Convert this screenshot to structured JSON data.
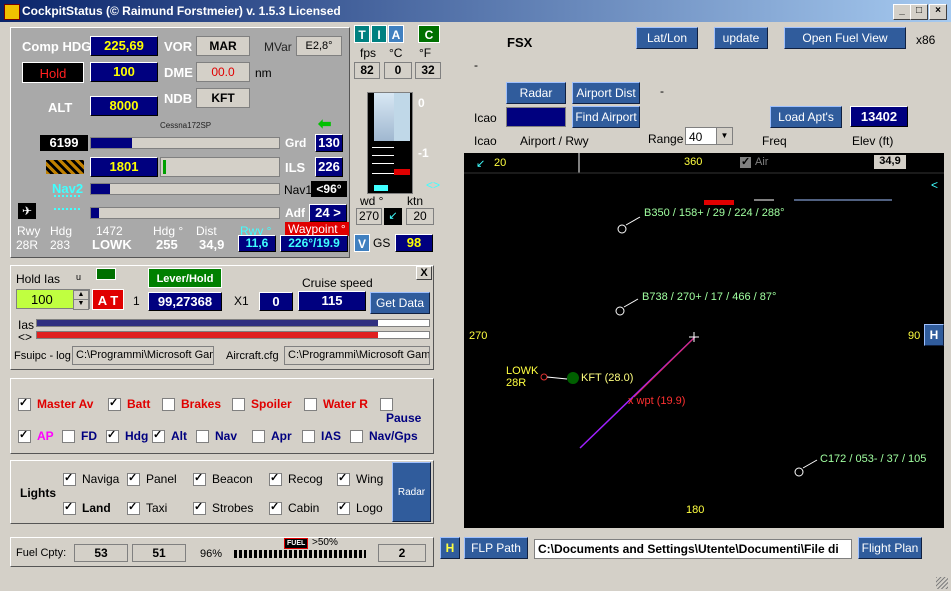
{
  "window": {
    "title": "CockpitStatus (© Raimund Forstmeier) v. 1.5.3 Licensed"
  },
  "instruments": {
    "comp_hdg_label": "Comp HDG",
    "comp_hdg": "225,69",
    "vor_label": "VOR",
    "vor": "MAR",
    "mvar_label": "MVar",
    "mvar": "E2,8°",
    "hold_label": "Hold",
    "hold_val": "100",
    "dme_label": "DME",
    "dme": "00.0",
    "dme_unit": "nm",
    "alt_label": "ALT",
    "alt": "8000",
    "ndb_label": "NDB",
    "ndb": "KFT",
    "aircraft": "Cessna172SP",
    "bar1_val": "6199",
    "grd_label": "Grd",
    "grd": "130",
    "bar2_val": "1801",
    "ils_label": "ILS",
    "ils": "226",
    "nav2_label": "Nav2",
    "nav1_label": "Nav1",
    "nav1": "<96°",
    "adf_label": "Adf",
    "adf": "24 >",
    "rwy_h": "Rwy",
    "hdg_h": "Hdg",
    "num_h": "1472",
    "hdgdeg_h": "Hdg °",
    "dist_h": "Dist",
    "rwy_deg_h": "Rwy °",
    "waypoint_h": "Waypoint °",
    "rwy": "28R",
    "hdg": "283",
    "apt": "LOWK",
    "hdg2": "255",
    "dist": "34,9",
    "rwy_deg": "11,6",
    "waypoint": "226°/19.9"
  },
  "env": {
    "t_btn": "T",
    "i_btn": "I",
    "a_btn": "A",
    "c_btn": "C",
    "fps_h": "fps",
    "c_h": "°C",
    "f_h": "°F",
    "fps": "82",
    "c": "0",
    "f": "32",
    "scale_0": "0",
    "scale_m1": "-1",
    "wd_label": "wd °",
    "ktn_label": "ktn",
    "wd": "270",
    "ktn": "20",
    "v_btn": "V",
    "gs_label": "GS",
    "gs": "98",
    "arrows": "<>"
  },
  "autothrottle": {
    "hold_ias_label": "Hold Ias",
    "u_label": "u",
    "ias_value": "100",
    "at_btn": "A T",
    "one": "1",
    "lever_btn": "Lever/Hold",
    "lever_val": "99,27368",
    "x1_label": "X1",
    "x1_val": "0",
    "cruise_label": "Cruise speed",
    "cruise_val": "115",
    "get_data_btn": "Get Data",
    "ias_label": "Ias",
    "arrows_label": "<>",
    "fsuipc_label": "Fsuipc - log",
    "fsuipc_path": "C:\\Programmi\\Microsoft Gam",
    "aircraft_cfg_label": "Aircraft.cfg",
    "aircraft_path": "C:\\Programmi\\Microsoft Gam",
    "close": "X"
  },
  "switches": {
    "row1": [
      {
        "label": "Master Av",
        "checked": true,
        "color": "red"
      },
      {
        "label": "Batt",
        "checked": true,
        "color": "red"
      },
      {
        "label": "Brakes",
        "checked": false,
        "color": "red"
      },
      {
        "label": "Spoiler",
        "checked": false,
        "color": "red"
      },
      {
        "label": "Water R",
        "checked": false,
        "color": "red"
      },
      {
        "label": "Pause",
        "checked": false,
        "color": "navy"
      }
    ],
    "row2": [
      {
        "label": "AP",
        "checked": true,
        "color": "magenta"
      },
      {
        "label": "FD",
        "checked": false,
        "color": "navy"
      },
      {
        "label": "Hdg",
        "checked": true,
        "color": "navy"
      },
      {
        "label": "Alt",
        "checked": true,
        "color": "navy"
      },
      {
        "label": "Nav",
        "checked": false,
        "color": "navy"
      },
      {
        "label": "Apr",
        "checked": false,
        "color": "navy"
      },
      {
        "label": "IAS",
        "checked": false,
        "color": "navy"
      },
      {
        "label": "Nav/Gps",
        "checked": false,
        "color": "navy"
      }
    ]
  },
  "lights": {
    "label": "Lights",
    "row1": [
      {
        "label": "Naviga",
        "checked": true
      },
      {
        "label": "Panel",
        "checked": true
      },
      {
        "label": "Beacon",
        "checked": true
      },
      {
        "label": "Recog",
        "checked": true
      },
      {
        "label": "Wing",
        "checked": true
      }
    ],
    "row2": [
      {
        "label": "Land",
        "checked": true,
        "bold": true
      },
      {
        "label": "Taxi",
        "checked": true
      },
      {
        "label": "Strobes",
        "checked": true
      },
      {
        "label": "Cabin",
        "checked": true
      },
      {
        "label": "Logo",
        "checked": true
      }
    ],
    "radar_btn": "Radar"
  },
  "fuel": {
    "label": "Fuel Cpty:",
    "left": "53",
    "right": "51",
    "pct": "96%",
    "fuel_tag": "FUEL",
    "over": ">50%",
    "tanks": "2",
    "level": 0.96
  },
  "right": {
    "sim": "FSX",
    "latlon_btn": "Lat/Lon",
    "update_btn": "update",
    "open_fuel_btn": "Open Fuel View",
    "x86": "x86",
    "dash1": "-",
    "dash2": "-",
    "radar_btn": "Radar",
    "airport_dist_btn": "Airport Dist",
    "icao_label": "Icao",
    "find_airport_btn": "Find Airport",
    "load_apts_btn": "Load Apt's",
    "apt_count": "13402",
    "icao2_label": "Icao",
    "airport_rwy_label": "Airport / Rwy",
    "range_label": "Range",
    "range": "40",
    "freq_label": "Freq",
    "elev_label": "Elev (ft)"
  },
  "map": {
    "top_heading": "360",
    "bottom_heading": "180",
    "left_heading": "270",
    "right_heading": "90",
    "wind_val": "20",
    "air_label": "Air",
    "dist_box": "34,9",
    "traffic": [
      {
        "label": "B350 / 158+ / 29 / 224 / 288°"
      },
      {
        "label": "B738 / 270+ / 17 / 466 / 87°"
      },
      {
        "label": "C172 / 053- / 37 / 105"
      }
    ],
    "airport": "LOWK",
    "runway": "28R",
    "ndb": "KFT (28.0)",
    "wpt": "x wpt (19.9)",
    "h_btn": "H",
    "left_arrow": "<"
  },
  "bottom": {
    "h_btn": "H",
    "flp_btn": "FLP Path",
    "flp_path": "C:\\Documents and Settings\\Utente\\Documenti\\File di",
    "flight_plan_btn": "Flight Plan"
  }
}
